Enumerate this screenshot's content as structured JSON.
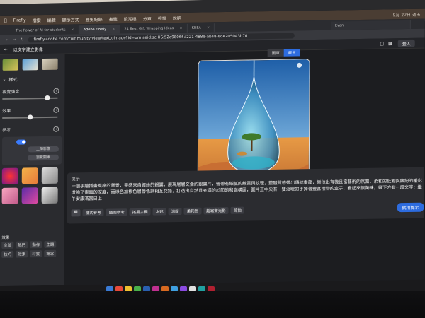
{
  "menubar": {
    "items": [
      "",
      "Firefly",
      "檔案",
      "編輯",
      "顯示方式",
      "歷史紀錄",
      "書籤",
      "設定檔",
      "分頁",
      "視窗",
      "說明"
    ],
    "clock": "9月 22日 週五"
  },
  "tabs": [
    {
      "label": "The Power of AI for students",
      "active": false
    },
    {
      "label": "Adobe Firefly",
      "active": true
    },
    {
      "label": "24 Best Gift Wrapping Ideas",
      "active": false
    },
    {
      "label": "KREA",
      "active": false
    }
  ],
  "profile": {
    "name": "Evan"
  },
  "address": {
    "url": "firefly.adobe.com/community/view/texttoimage?id=urn:aaid:sc:US:52a9806f-a221-488e-ab48-8de205043b70"
  },
  "app": {
    "title": "以文字建立影像",
    "login_label": "登入"
  },
  "sidebar": {
    "style_label": "樣式",
    "intensity_label": "視覺強度",
    "intensity_value": 0.85,
    "effect_label": "效果",
    "effect_value": 0.5,
    "reference_label": "參考",
    "upload_label": "上傳影像",
    "gallery_label": "瀏覽圖庫",
    "effects_section": "效果",
    "effect_chips": [
      "全部",
      "熱門",
      "動作",
      "主題",
      "技巧",
      "效果",
      "材質",
      "概念"
    ]
  },
  "canvas": {
    "mode_tabs": [
      "圖庫",
      "產生"
    ],
    "active_mode": "產生",
    "art_tag": "報告"
  },
  "prompt": {
    "label": "提示",
    "text": "一個手繪插畫風格的背景，靈感來自繽紛的銀翼，展現層層交疊的銀翼片，營帶有細膩的線質與紋理，整體質感帶出傳統畫韻，樂他出有機且富藝術的氛圍，柔和的低飽與繽紛的暖彩增強了畫面的深度，而綠色加根色層營色調相互交錯，打造出自然且充滿的於節的和諧構圖，圖片正中央有一雙溫暖的手捧著豐富禮物的盒子，看起來很美味，畫下方有一段文字：繼午安康滿園日上",
    "tags": [
      "樣式參考",
      "插圖參考",
      "搖擺主義",
      "水彩",
      "溫暖",
      "柔和色",
      "超寫實光影",
      "節拍"
    ],
    "generate_label": "試用提示"
  },
  "colors": {
    "accent": "#2d6cdf",
    "bg": "#1e1f22",
    "panel": "#2a2b2f"
  }
}
